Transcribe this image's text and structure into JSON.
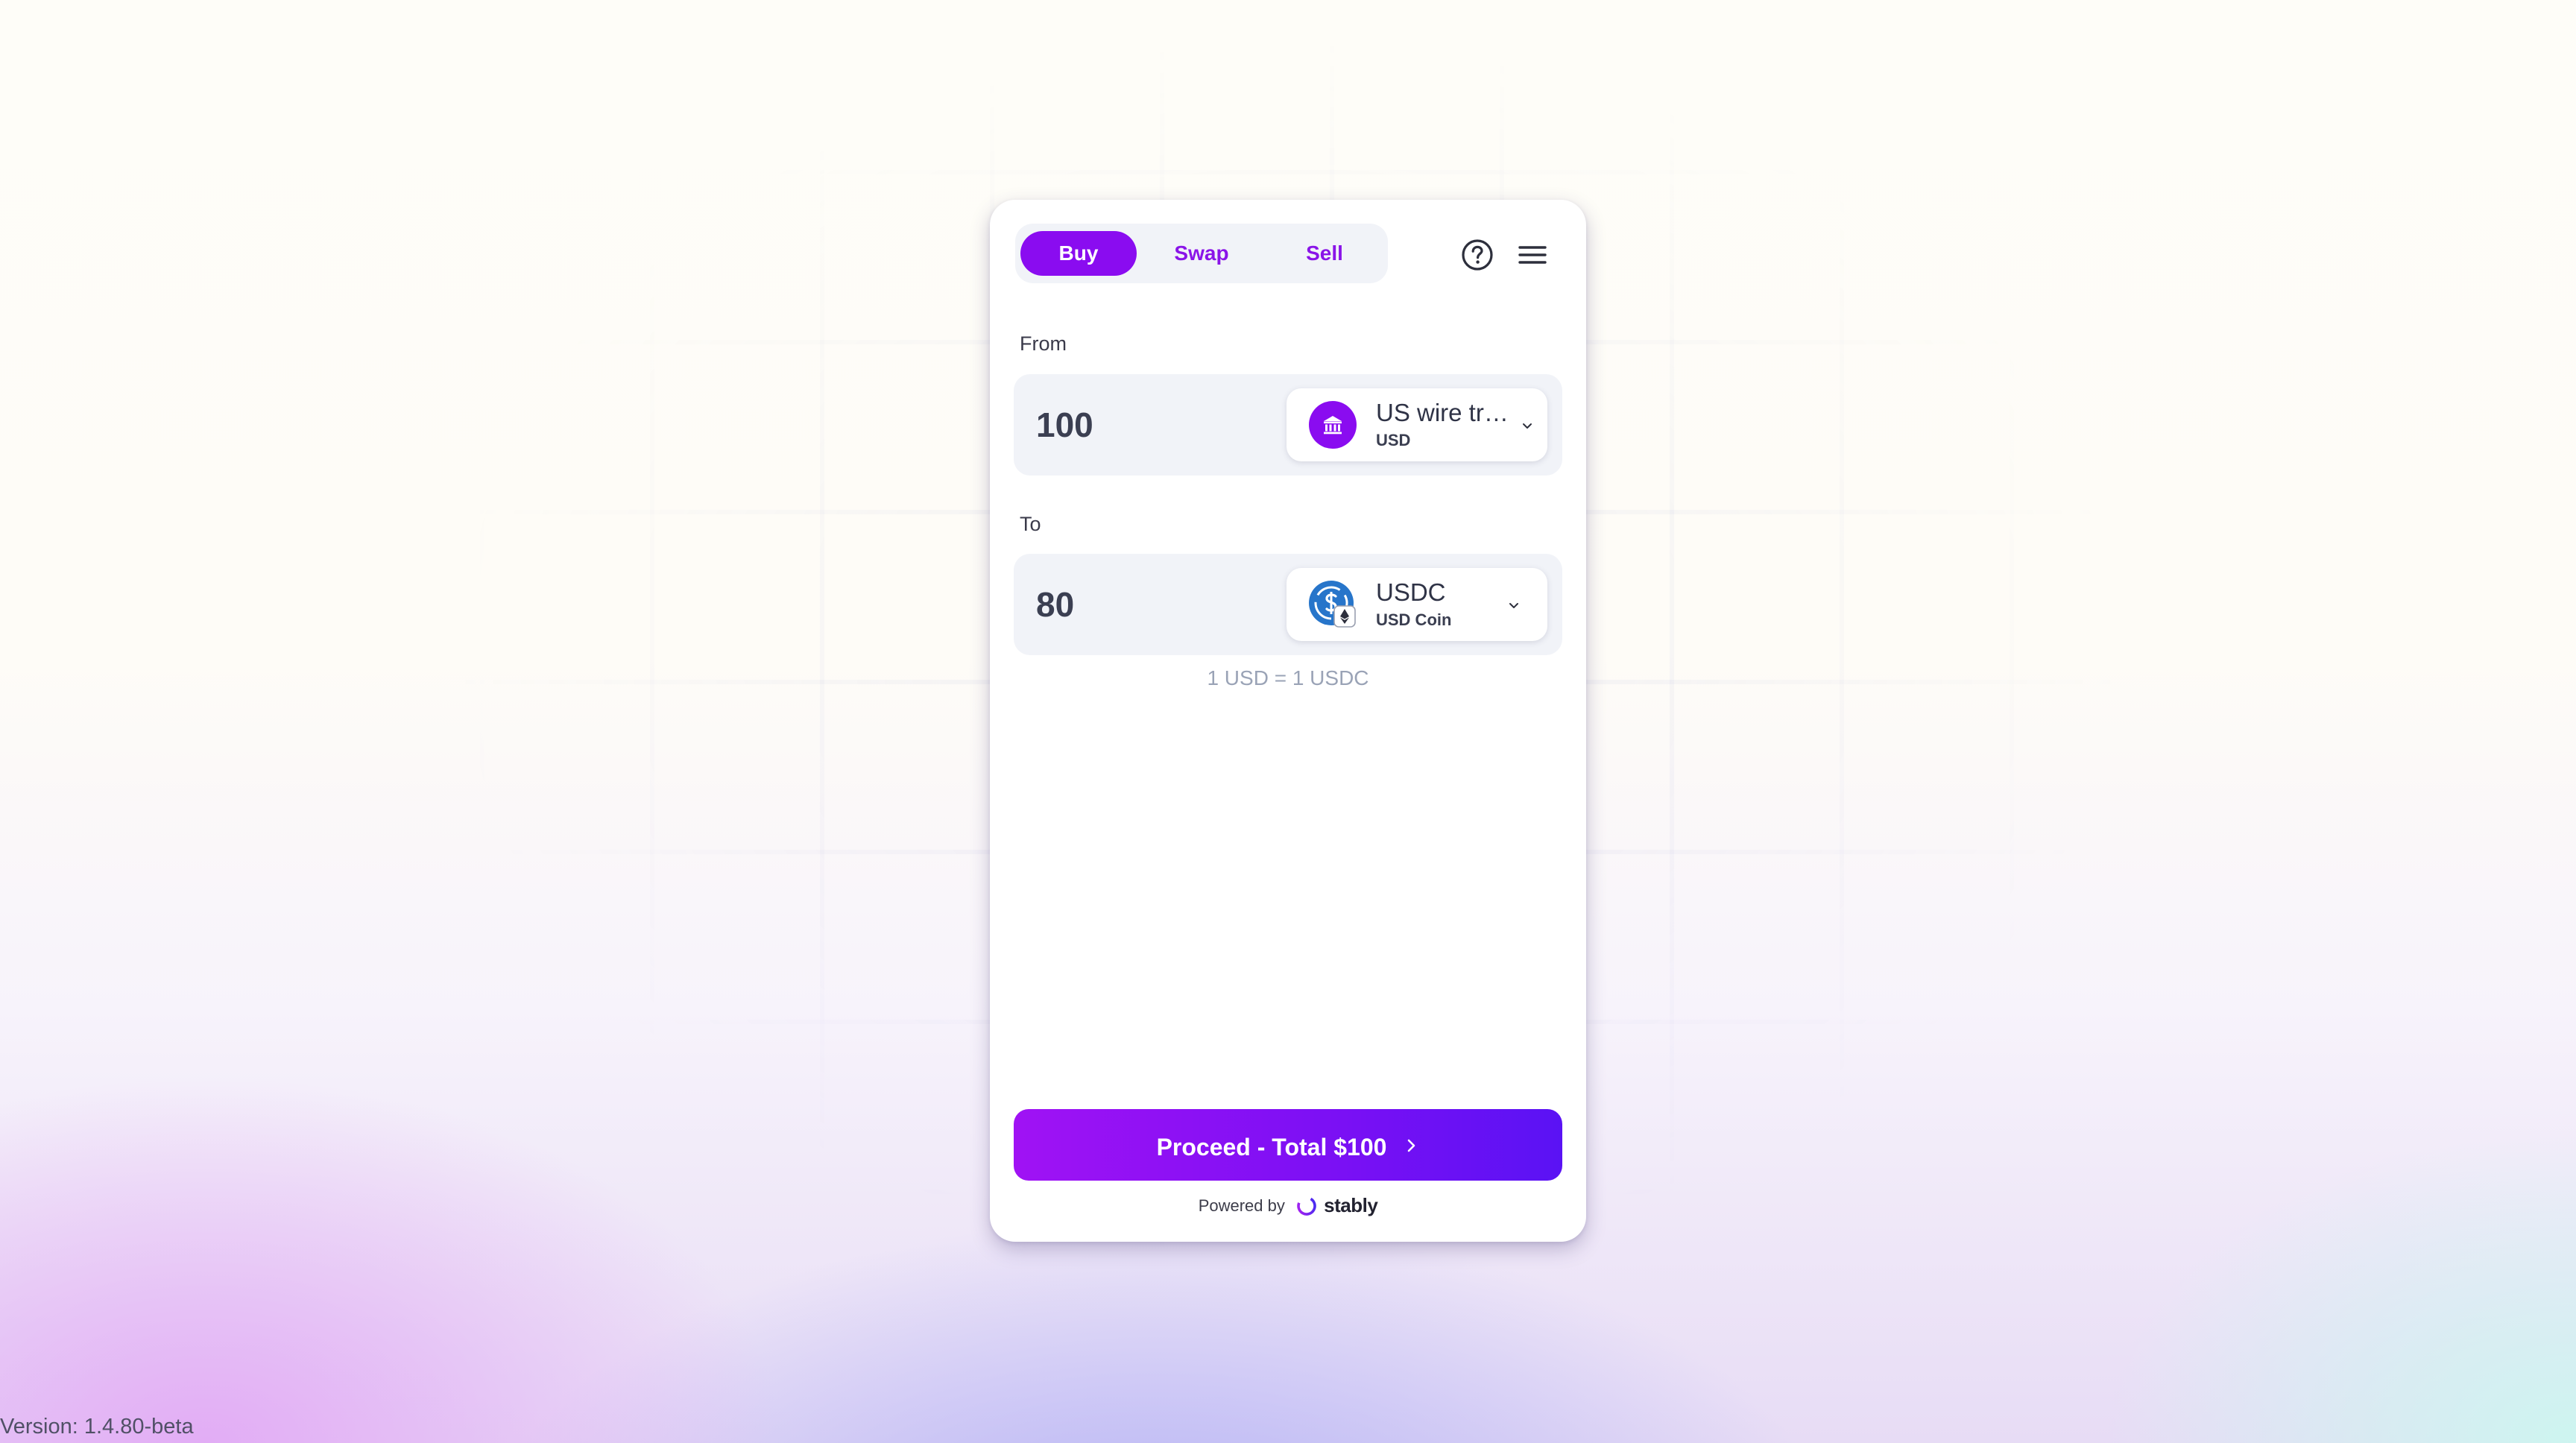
{
  "tabs": {
    "buy": "Buy",
    "swap": "Swap",
    "sell": "Sell",
    "active": "Buy"
  },
  "header": {
    "help_icon": "help-circle-icon",
    "menu_icon": "hamburger-menu-icon"
  },
  "from": {
    "label": "From",
    "amount": "100",
    "method_title": "US wire transfer",
    "method_currency": "USD",
    "icon": "bank-icon"
  },
  "to": {
    "label": "To",
    "amount": "80",
    "asset_symbol": "USDC",
    "asset_name": "USD Coin",
    "icon": "usdc-icon",
    "network_icon": "ethereum-icon"
  },
  "rate": "1 USD = 1 USDC",
  "proceed": {
    "label": "Proceed - Total $100"
  },
  "footer": {
    "powered_by": "Powered by",
    "brand": "stably"
  },
  "version": "Version: 1.4.80-beta",
  "colors": {
    "accent": "#8a0cf0",
    "usdc_blue": "#2775ca",
    "panel": "#f1f3f8"
  }
}
